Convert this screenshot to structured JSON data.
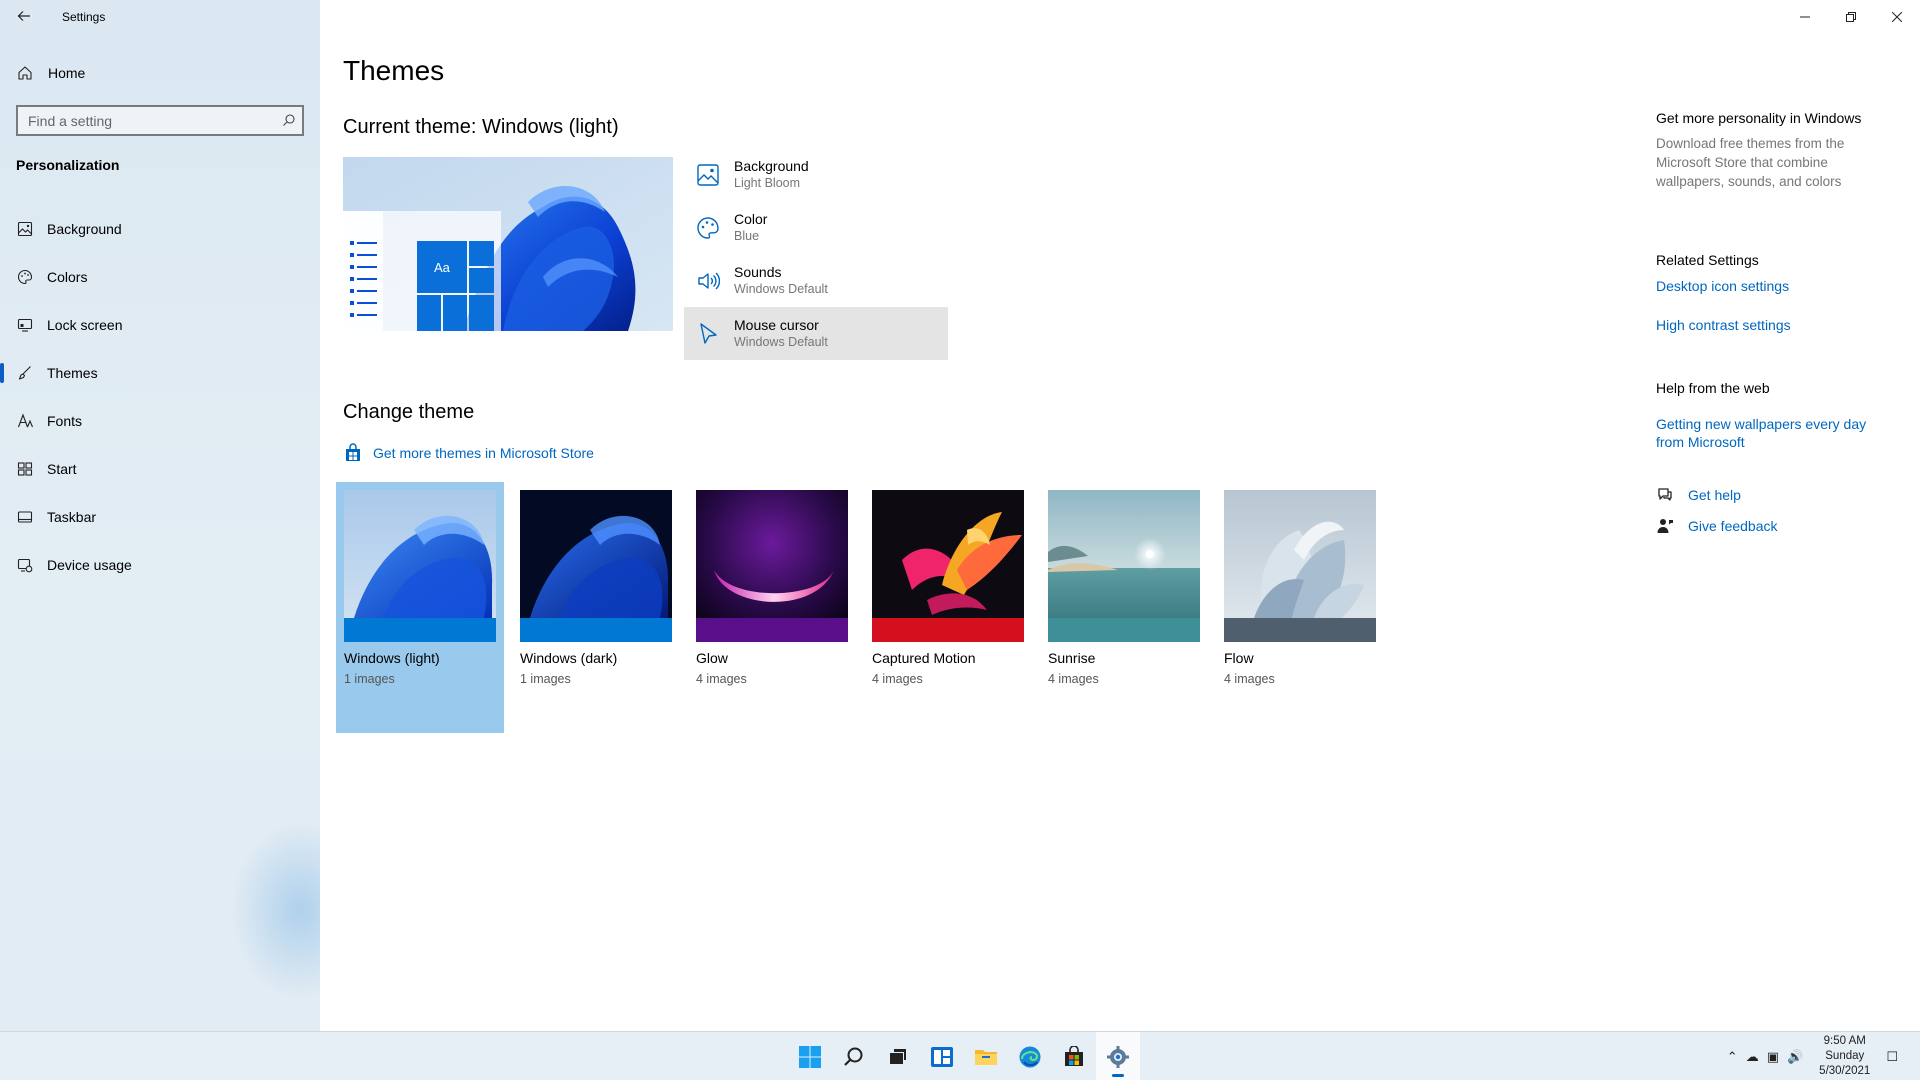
{
  "window": {
    "title": "Settings",
    "controls": [
      "minimize",
      "restore",
      "close"
    ]
  },
  "sidebar": {
    "home_label": "Home",
    "search_placeholder": "Find a setting",
    "section_title": "Personalization",
    "items": [
      {
        "label": "Background",
        "icon": "picture-icon"
      },
      {
        "label": "Colors",
        "icon": "palette-icon"
      },
      {
        "label": "Lock screen",
        "icon": "monitor-icon"
      },
      {
        "label": "Themes",
        "icon": "brush-icon",
        "active": true
      },
      {
        "label": "Fonts",
        "icon": "font-icon"
      },
      {
        "label": "Start",
        "icon": "start-grid-icon"
      },
      {
        "label": "Taskbar",
        "icon": "taskbar-icon"
      },
      {
        "label": "Device usage",
        "icon": "device-usage-icon"
      }
    ]
  },
  "main": {
    "page_title": "Themes",
    "current_theme_heading": "Current theme: Windows (light)",
    "preview_tile_label": "Aa",
    "properties": [
      {
        "title": "Background",
        "value": "Light Bloom",
        "icon": "picture-icon"
      },
      {
        "title": "Color",
        "value": "Blue",
        "icon": "palette-icon"
      },
      {
        "title": "Sounds",
        "value": "Windows Default",
        "icon": "speaker-icon"
      },
      {
        "title": "Mouse cursor",
        "value": "Windows Default",
        "icon": "cursor-icon",
        "highlighted": true
      }
    ],
    "change_theme_heading": "Change theme",
    "store_link": "Get more themes in Microsoft Store",
    "themes": [
      {
        "name": "Windows (light)",
        "count": "1 images",
        "selected": true,
        "bar_color": "#0078d4"
      },
      {
        "name": "Windows (dark)",
        "count": "1 images",
        "selected": false,
        "bar_color": "#0078d4"
      },
      {
        "name": "Glow",
        "count": "4 images",
        "selected": false,
        "bar_color": "#5a0f8a"
      },
      {
        "name": "Captured Motion",
        "count": "4 images",
        "selected": false,
        "bar_color": "#d4101e"
      },
      {
        "name": "Sunrise",
        "count": "4 images",
        "selected": false,
        "bar_color": "#3e8f98"
      },
      {
        "name": "Flow",
        "count": "4 images",
        "selected": false,
        "bar_color": "#4f5f6e"
      }
    ]
  },
  "right": {
    "personality_heading": "Get more personality in Windows",
    "personality_text": "Download free themes from the Microsoft Store that combine wallpapers, sounds, and colors",
    "related_heading": "Related Settings",
    "related_links": [
      "Desktop icon settings",
      "High contrast settings"
    ],
    "help_heading": "Help from the web",
    "help_link": "Getting new wallpapers every day from Microsoft",
    "get_help": "Get help",
    "give_feedback": "Give feedback"
  },
  "taskbar": {
    "time": "9:50 AM",
    "day": "Sunday",
    "date": "5/30/2021",
    "apps": [
      "start-icon",
      "search-icon",
      "task-view-icon",
      "widgets-icon",
      "file-explorer-icon",
      "edge-icon",
      "store-icon",
      "settings-icon"
    ],
    "active_app": "settings-icon"
  },
  "colors": {
    "accent": "#0067c0",
    "selected_theme_bg": "#99c9ec",
    "sidebar_bg": "#dfeaf3",
    "highlight_row": "#e4e4e4"
  }
}
